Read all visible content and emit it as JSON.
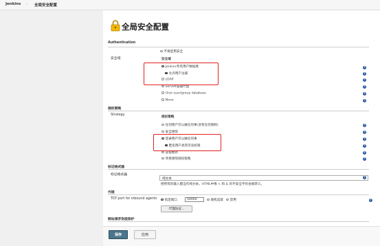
{
  "breadcrumb": {
    "root": "Jenkins",
    "separator": "›",
    "current": "全局安全配置"
  },
  "page": {
    "title": "全局安全配置"
  },
  "sections": {
    "authentication": "Authentication",
    "authorization": "授权策略",
    "markup": "标记格式器",
    "proxy": "代理",
    "csrf": "跨站请求伪造保护"
  },
  "security_realm": {
    "label": "安全域",
    "disable_option": "不要启用安全",
    "heading": "安全域",
    "options": [
      {
        "label": "Jenkins专有用户数据库",
        "selected": true
      },
      {
        "label": "LDAP",
        "selected": false
      },
      {
        "label": "Servlet容器代理",
        "selected": false
      },
      {
        "label": "Unix user/group database",
        "selected": false
      },
      {
        "label": "None",
        "selected": false
      }
    ],
    "allow_signup": {
      "label": "允许用户注册",
      "checked": true
    }
  },
  "authorization": {
    "label": "Strategy",
    "heading": "授权策略",
    "options": [
      {
        "label": "任何用户可以做任何事(没有任何限制)",
        "selected": false
      },
      {
        "label": "安全矩阵",
        "selected": false
      },
      {
        "label": "登录用户可以做任何事",
        "selected": true
      },
      {
        "label": "遗留模式",
        "selected": false
      },
      {
        "label": "项目矩阵授权策略",
        "selected": false
      }
    ],
    "anonymous_read": {
      "label": "匿名用户具有可读权限",
      "checked": true
    }
  },
  "markup_formatter": {
    "label": "标记格式器",
    "value": "纯文本",
    "description": "把所有的输入都当作纯文本。HTML中像 < 和 & 的不安全字符会被转义。"
  },
  "agents": {
    "label": "TCP port for inbound agents",
    "options": [
      {
        "label": "指定端口",
        "selected": true
      },
      {
        "label": "随机选取",
        "selected": false
      },
      {
        "label": "禁用",
        "selected": false
      }
    ],
    "port_value": "50000",
    "proxy_button": "代理协议..."
  },
  "footer": {
    "save": "保存",
    "apply": "应用"
  },
  "colors": {
    "highlight": "#e02020",
    "save_button": "#4b758b",
    "help_icon": "#2c5aa0"
  },
  "icons": {
    "title": "lock-icon",
    "help": "help-icon"
  }
}
